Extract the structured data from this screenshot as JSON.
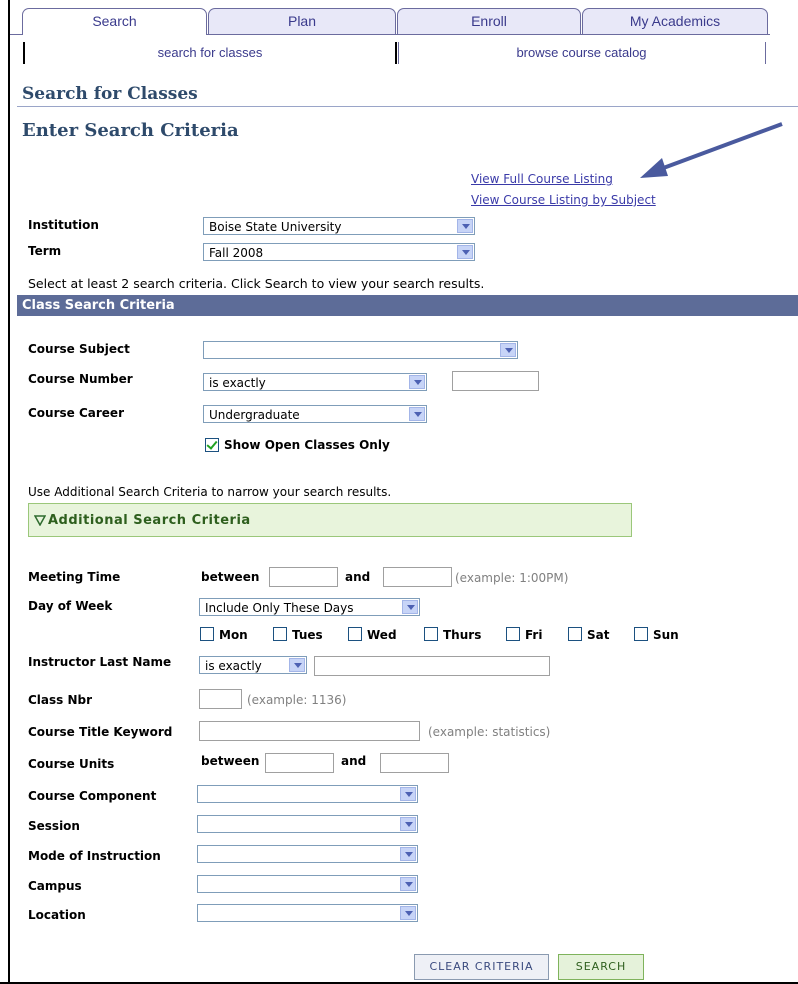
{
  "tabs": [
    "Search",
    "Plan",
    "Enroll",
    "My Academics"
  ],
  "subtabs": [
    "search for classes",
    "browse course catalog"
  ],
  "page_title": "Search for Classes",
  "section_title": "Enter Search Criteria",
  "links": {
    "full_listing": "View Full Course Listing",
    "by_subject": "View Course Listing by Subject"
  },
  "institution": {
    "label": "Institution",
    "value": "Boise State University"
  },
  "term": {
    "label": "Term",
    "value": "Fall 2008"
  },
  "instruction": "Select at least 2 search criteria. Click Search to view your search results.",
  "class_search_header": "Class Search Criteria",
  "course_subject": {
    "label": "Course Subject",
    "value": ""
  },
  "course_number": {
    "label": "Course Number",
    "operator": "is exactly",
    "value": ""
  },
  "course_career": {
    "label": "Course Career",
    "value": "Undergraduate"
  },
  "show_open": {
    "label": "Show Open Classes Only",
    "checked": true
  },
  "additional_note": "Use Additional Search Criteria to narrow your search results.",
  "additional_header": "Additional Search Criteria",
  "meeting_time": {
    "label": "Meeting Time",
    "between": "between",
    "and": "and",
    "example": "(example: 1:00PM)"
  },
  "day_of_week": {
    "label": "Day of Week",
    "value": "Include Only These Days",
    "days": [
      "Mon",
      "Tues",
      "Wed",
      "Thurs",
      "Fri",
      "Sat",
      "Sun"
    ]
  },
  "instructor": {
    "label": "Instructor Last Name",
    "operator": "is exactly",
    "value": ""
  },
  "class_nbr": {
    "label": "Class Nbr",
    "example": "(example: 1136)"
  },
  "title_keyword": {
    "label": "Course Title Keyword",
    "example": "(example: statistics)"
  },
  "course_units": {
    "label": "Course Units",
    "between": "between",
    "and": "and"
  },
  "course_component": {
    "label": "Course Component",
    "value": ""
  },
  "session": {
    "label": "Session",
    "value": ""
  },
  "mode": {
    "label": "Mode of Instruction",
    "value": ""
  },
  "campus": {
    "label": "Campus",
    "value": ""
  },
  "location": {
    "label": "Location",
    "value": ""
  },
  "buttons": {
    "clear": "Clear Criteria",
    "search": "Search"
  }
}
